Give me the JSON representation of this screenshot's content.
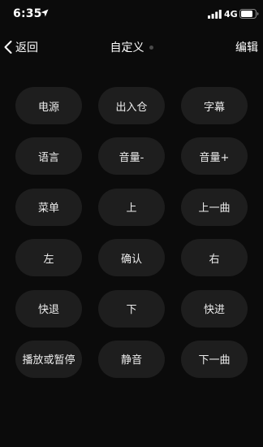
{
  "status_bar": {
    "time": "6:35",
    "network": "4G",
    "icons": [
      "location-arrow-icon",
      "signal-bars-icon",
      "battery-icon"
    ]
  },
  "nav": {
    "back_label": "返回",
    "title": "自定义",
    "edit_label": "编辑",
    "icons": [
      "chevron-left-icon"
    ]
  },
  "keys": [
    {
      "label": "电源"
    },
    {
      "label": "出入仓"
    },
    {
      "label": "字幕"
    },
    {
      "label": "语言"
    },
    {
      "label": "音量-"
    },
    {
      "label": "音量+"
    },
    {
      "label": "菜单"
    },
    {
      "label": "上"
    },
    {
      "label": "上一曲"
    },
    {
      "label": "左"
    },
    {
      "label": "确认"
    },
    {
      "label": "右"
    },
    {
      "label": "快退"
    },
    {
      "label": "下"
    },
    {
      "label": "快进"
    },
    {
      "label": "播放或暂停"
    },
    {
      "label": "静音"
    },
    {
      "label": "下一曲"
    }
  ],
  "colors": {
    "background": "#0b0b0b",
    "key_background": "#1e1e1e",
    "text": "#ffffff"
  }
}
